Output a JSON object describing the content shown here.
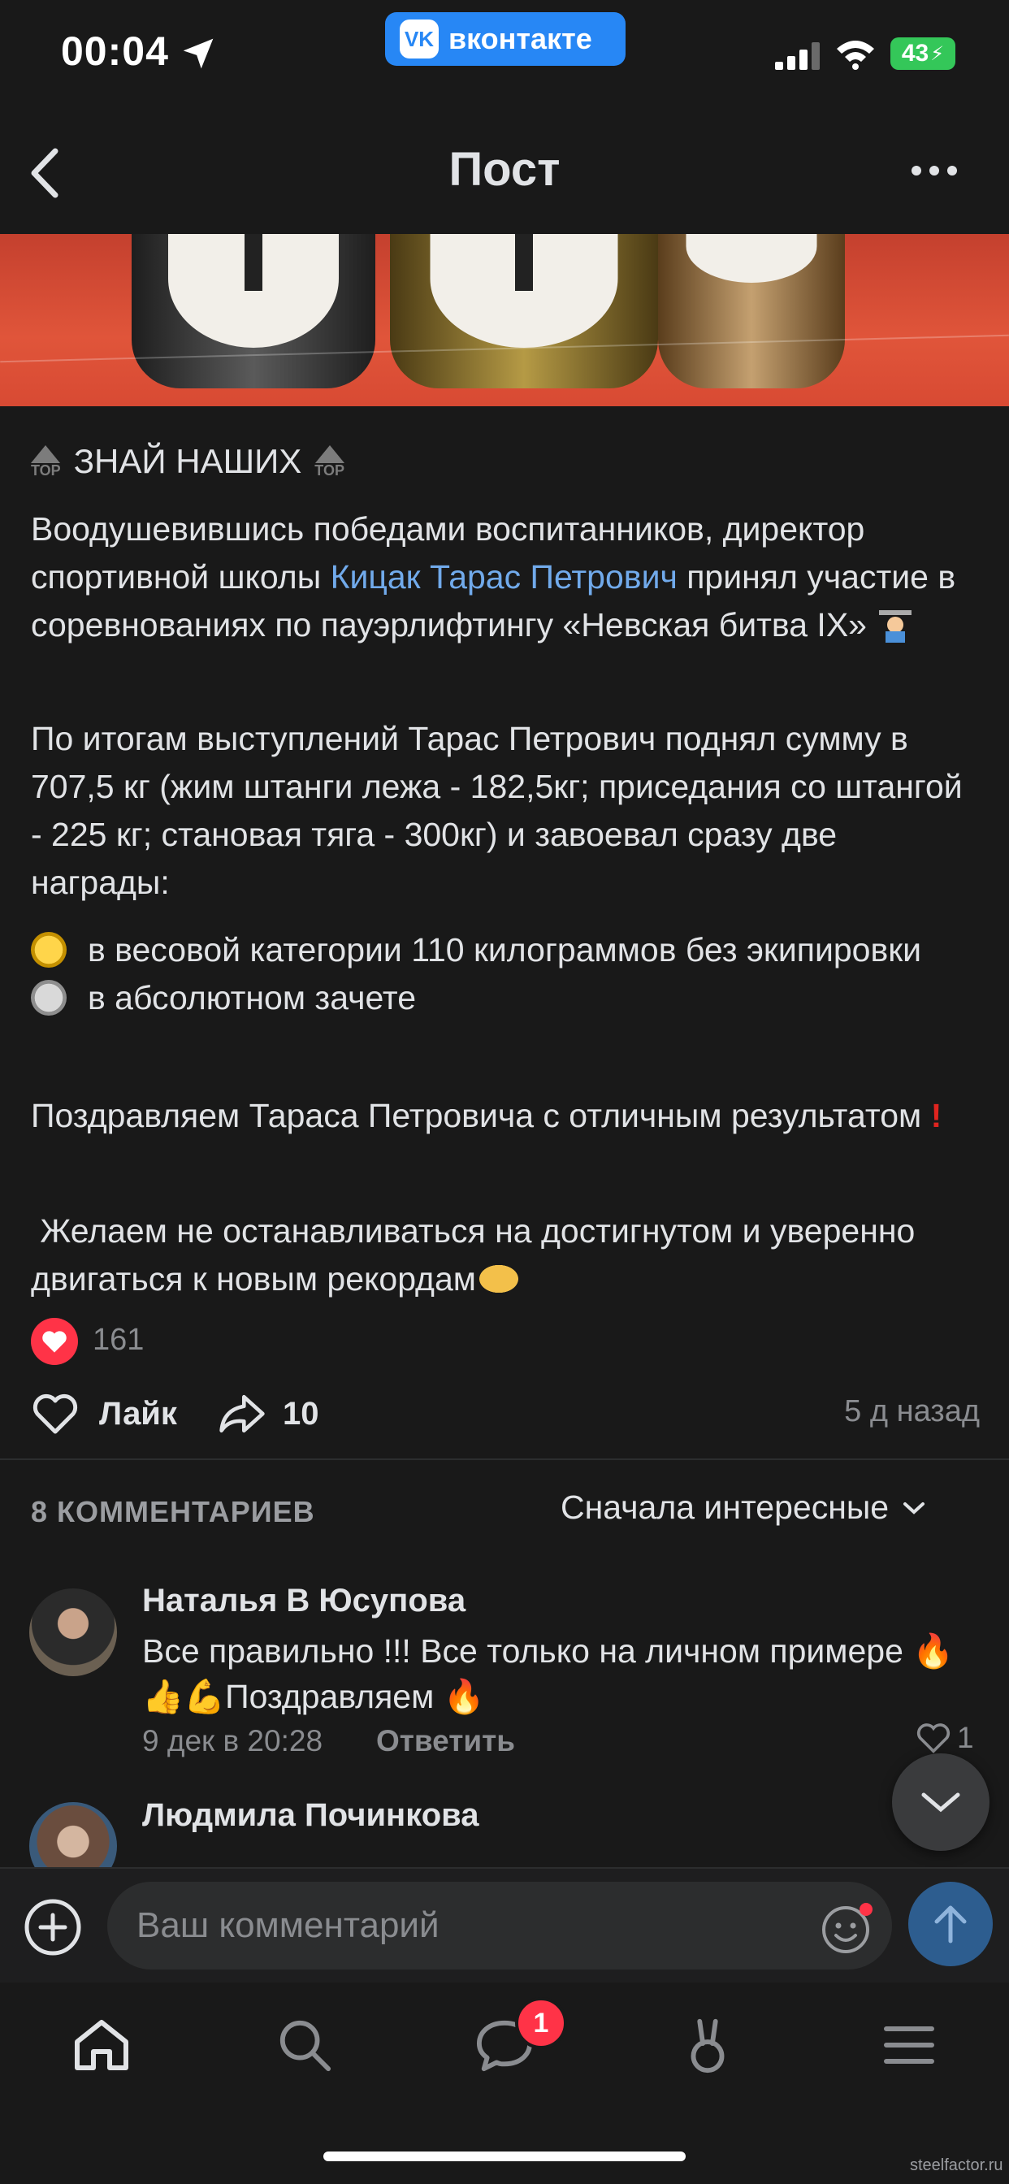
{
  "status_bar": {
    "time": "00:04",
    "app_badge": "вконтакте",
    "battery": "43"
  },
  "nav": {
    "title": "Пост"
  },
  "post": {
    "tag_label": "ЗНАЙ НАШИХ",
    "top_mark": "TOP",
    "p1_before": "Воодушевившись победами воспитанников, директор спортивной школы ",
    "p1_link": "Кицак Тарас Петрович",
    "p1_after": " принял участие в соревнованиях по пауэрлифтингу «Невская битва IX»",
    "p2": "По итогам выступлений Тарас Петрович поднял сумму в 707,5 кг (жим штанги лежа - 182,5кг; приседания со штангой - 225 кг; становая тяга - 300кг) и завоевал сразу две награды:",
    "award1": "в весовой категории 110 килограммов без экипировки",
    "award2": "в абсолютном зачете",
    "p3": "Поздравляем Тараса Петровича с отличным результатом",
    "p4": " Желаем не останавливаться на достигнутом и уверенно двигаться к новым рекордам",
    "likes_count": "161",
    "like_label": "Лайк",
    "shares_count": "10",
    "time_ago": "5 д назад"
  },
  "comments": {
    "count_label": "8 КОММЕНТАРИЕВ",
    "sort_label": "Сначала интересные",
    "items": [
      {
        "author": "Наталья В Юсупова",
        "text": "Все правильно !!! Все только на личном примере 🔥👍💪Поздравляем 🔥",
        "date": "9 дек в 20:28",
        "reply_label": "Ответить",
        "likes": "1"
      },
      {
        "author": "Людмила Починкова"
      }
    ]
  },
  "composer": {
    "placeholder": "Ваш комментарий"
  },
  "tabbar": {
    "messages_badge": "1"
  },
  "watermark": "steelfactor.ru",
  "colors": {
    "background": "#191919",
    "accent": "#2787f5",
    "link": "#71aaeb",
    "like_red": "#ff3347"
  }
}
